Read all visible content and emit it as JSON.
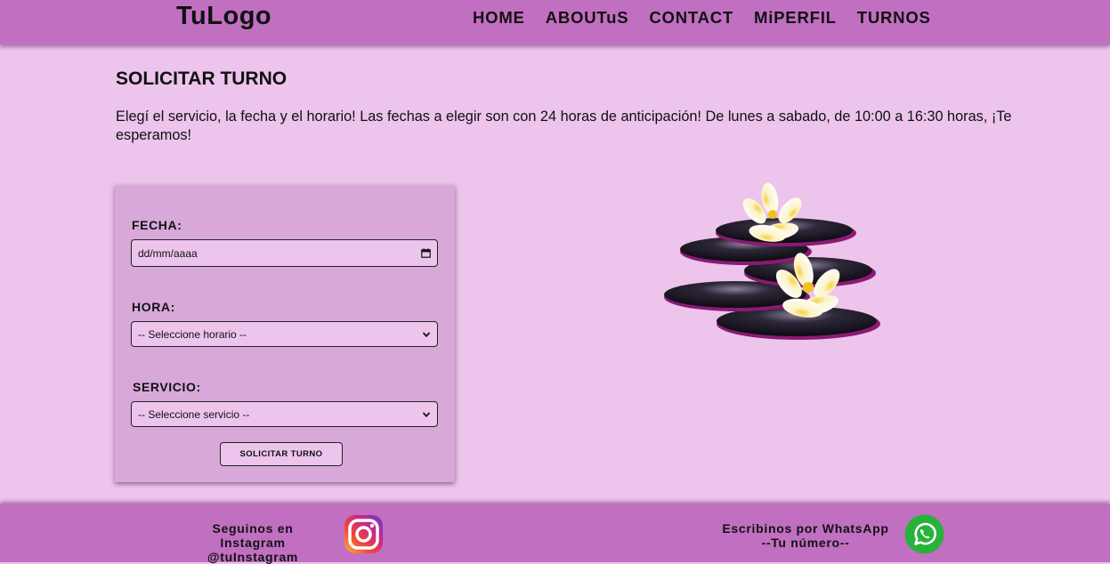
{
  "header": {
    "logo": "TuLogo",
    "nav": [
      "HOME",
      "ABOUTuS",
      "CONTACT",
      "MiPERFIL",
      "TURNOS"
    ]
  },
  "main": {
    "title": "SOLICITAR TURNO",
    "intro": "Elegí el servicio, la fecha y el horario! Las fechas a elegir son con 24 horas de anticipación! De lunes a sabado, de 10:00 a 16:30 horas, ¡Te esperamos!"
  },
  "form": {
    "fecha_label": "FECHA:",
    "fecha_placeholder": "dd/mm/aaaa",
    "hora_label": "HORA:",
    "hora_value": "-- Seleccione horario --",
    "servicio_label": "SERVICIO:",
    "servicio_value": "-- Seleccione servicio --",
    "submit_label": "SOLICITAR TURNO"
  },
  "footer": {
    "instagram_line1": "Seguinos en Instagram",
    "instagram_line2": "@tuInstagram",
    "whatsapp_line1": "Escribinos por WhatsApp",
    "whatsapp_line2": "--Tu número--"
  },
  "icons": {
    "calendar": "calendar-icon",
    "dropdown": "chevron-down-icon",
    "instagram": "instagram-icon",
    "whatsapp": "whatsapp-icon"
  },
  "colors": {
    "bars": "#c16fc1",
    "background": "#ecc4ec",
    "form_card": "#d8a8d8"
  }
}
